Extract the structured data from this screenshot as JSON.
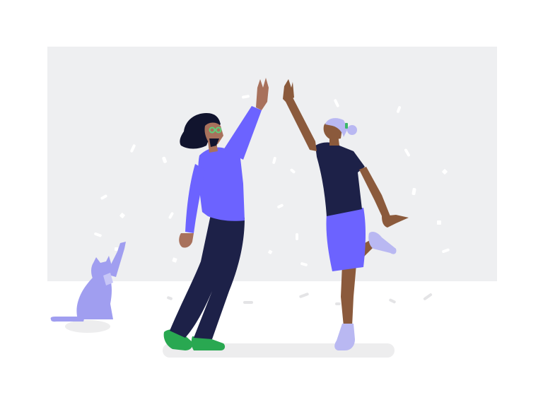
{
  "illustration": {
    "subject": "high-five-celebration",
    "elements": [
      "backdrop-panel",
      "confetti",
      "man",
      "woman",
      "cat",
      "floor-shadow"
    ]
  },
  "colors": {
    "background": "#ffffff",
    "backdrop": "#eeeff1",
    "floor_shadow": "#ededee",
    "confetti": "#ffffff",
    "man_shirt": "#6c63ff",
    "man_pants": "#1d2148",
    "man_hair": "#11142e",
    "man_shoes": "#29a851",
    "glasses": "#5fd07a",
    "man_skin": "#a8715c",
    "woman_top": "#1d2148",
    "woman_shorts": "#6c63ff",
    "woman_skin": "#8b5a3c",
    "woman_hair": "#b9b8f2",
    "woman_shoes": "#b9b8f2",
    "hair_tie": "#3cb86a",
    "cat": "#a09ef0",
    "cat_shadow": "#e6e6e8"
  }
}
